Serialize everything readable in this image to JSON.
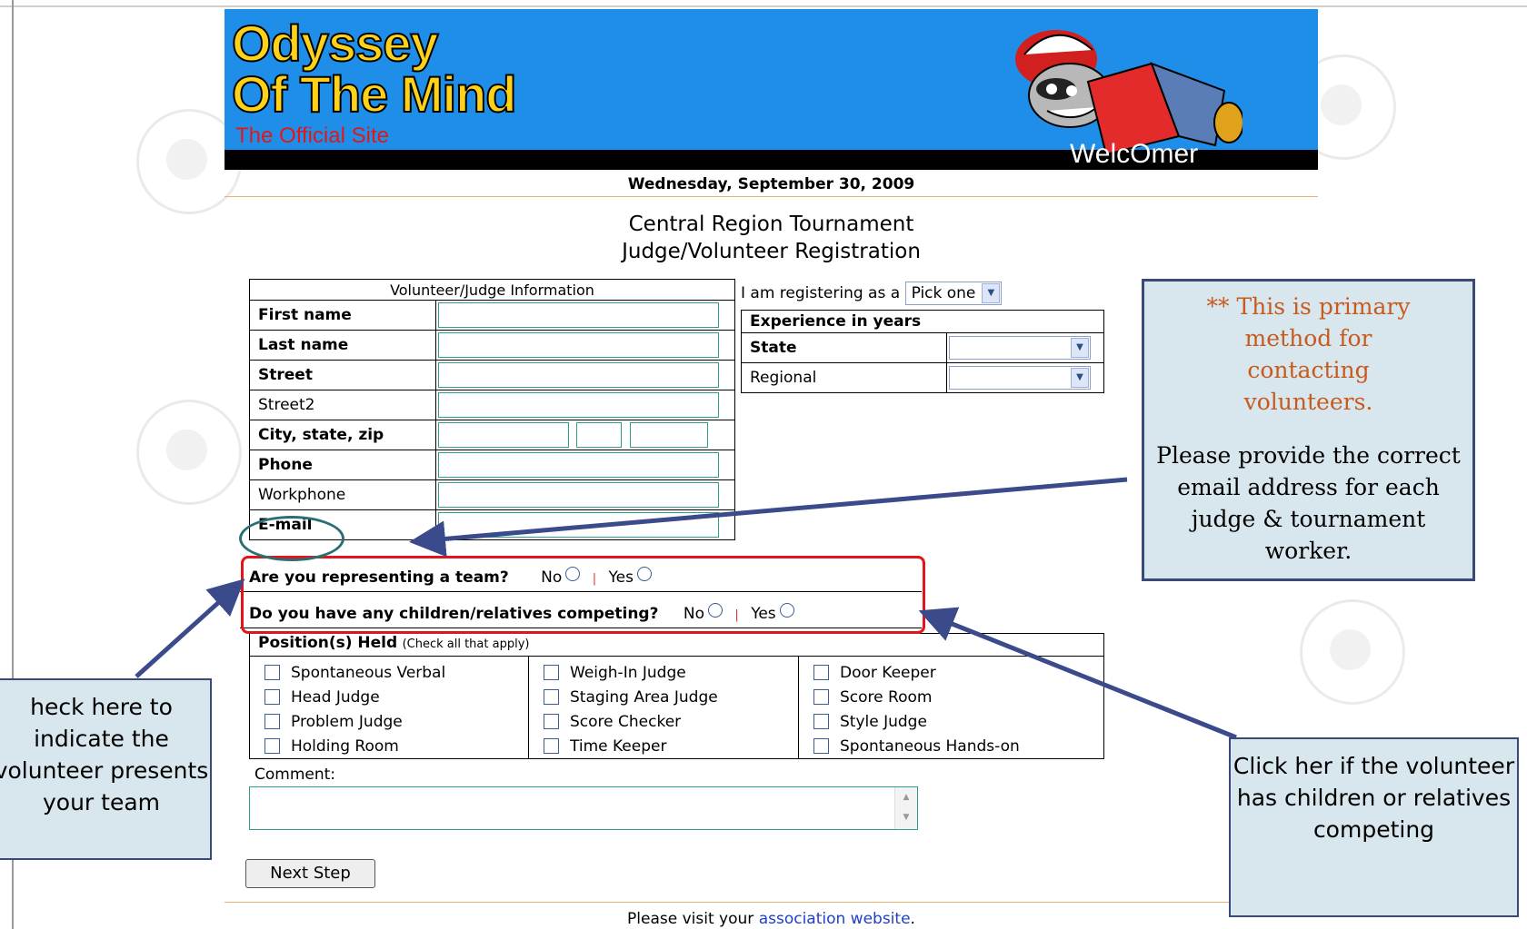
{
  "banner": {
    "title_line1": "Odyssey",
    "title_line2": "Of The Mind",
    "subtitle": "The Official Site",
    "welcome": "WelcOmer"
  },
  "date": "Wednesday, September 30, 2009",
  "page_title": {
    "line1": "Central Region Tournament",
    "line2": "Judge/Volunteer Registration"
  },
  "volunteer_info": {
    "header": "Volunteer/Judge Information",
    "first_name": "First name",
    "last_name": "Last name",
    "street": "Street",
    "street2": "Street2",
    "city_state_zip": "City, state, zip",
    "phone": "Phone",
    "workphone": "Workphone",
    "email": "E-mail"
  },
  "registering": {
    "label": "I am registering as a",
    "selected": "Pick one"
  },
  "experience": {
    "header": "Experience in years",
    "state": "State",
    "regional": "Regional"
  },
  "questions": {
    "team": "Are you representing a team?",
    "children": "Do you have any children/relatives competing?",
    "no": "No",
    "yes": "Yes",
    "separator": "|"
  },
  "positions": {
    "header": "Position(s) Held",
    "hint": "(Check all that apply)",
    "col1": [
      "Spontaneous Verbal",
      "Head Judge",
      "Problem Judge",
      "Holding Room"
    ],
    "col2": [
      "Weigh-In Judge",
      "Staging Area Judge",
      "Score Checker",
      "Time Keeper"
    ],
    "col3": [
      "Door Keeper",
      "Score Room",
      "Style Judge",
      "Spontaneous Hands-on"
    ]
  },
  "comment_label": "Comment:",
  "next_button": "Next Step",
  "footer": {
    "prefix": "Please visit your ",
    "link": "association website",
    "suffix": "."
  },
  "note_box": {
    "primary": "**  This is primary method for contacting volunteers.",
    "body": "Please provide the correct email address for each judge & tournament worker."
  },
  "callout_left": "heck here to indicate the volunteer presents your team",
  "callout_right": "Click her if the volunteer has children or relatives competing",
  "colors": {
    "banner_blue": "#1f8ee8",
    "title_yellow": "#ffd21a",
    "subtitle_red": "#e01818",
    "highlight_red": "#e4141c",
    "callout_bg": "#d8e7ee",
    "callout_border": "#3a4a78",
    "note_red": "#c85a1e",
    "link_blue": "#2040c8"
  },
  "icons": [
    "mascot-raccoon-icon",
    "select-arrow-icon",
    "radio-icon",
    "checkbox-icon",
    "scroll-up-icon",
    "scroll-down-icon",
    "arrow-annotation-icon"
  ]
}
